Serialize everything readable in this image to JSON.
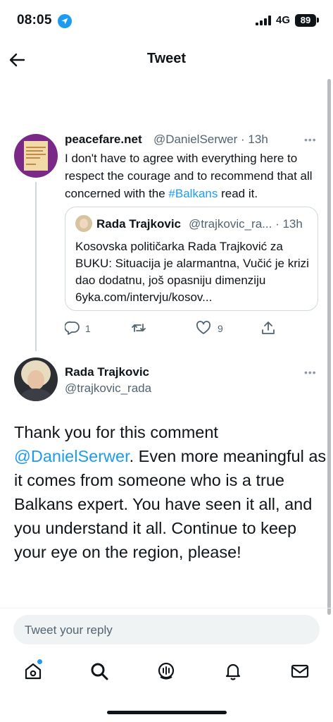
{
  "status_bar": {
    "time": "08:05",
    "network": "4G",
    "battery": "89"
  },
  "header": {
    "title": "Tweet"
  },
  "original_tweet": {
    "name": "peacefare.net",
    "handle_time": "@DanielSerwer · 13h",
    "text_before": "I don't have to agree with everything here to respect the courage and to recommend that all concerned with the ",
    "hashtag": "#Balkans",
    "text_after": " read it.",
    "more": "•••"
  },
  "quoted_tweet": {
    "name": "Rada Trajkovic",
    "handle_time": "@trajkovic_ra... · 13h",
    "text": "Kosovska političarka Rada Trajković za BUKU: Situacija je alarmantna, Vučić je krizi dao dodatnu, još opasniju dimenziju 6yka.com/intervju/kosov..."
  },
  "actions": {
    "replies": "1",
    "likes": "9"
  },
  "reply_tweet": {
    "name": "Rada Trajkovic",
    "handle": "@trajkovic_rada",
    "more": "•••",
    "text_before": "Thank you for this comment ",
    "mention": "@DanielSerwer",
    "text_after": ". Even more meaningful as it comes from someone who is a true Balkans expert. You have seen it all, and you understand it all. Continue to keep your eye on the region, please!"
  },
  "reply_box": {
    "placeholder": "Tweet your reply"
  },
  "colors": {
    "accent": "#1d9bf0",
    "text": "#0f1419",
    "secondary": "#536471"
  }
}
